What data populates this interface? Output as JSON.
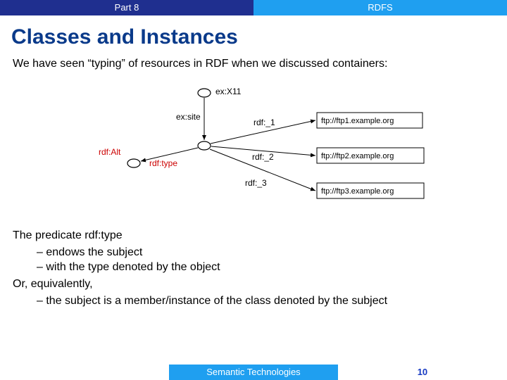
{
  "header": {
    "left": "Part 8",
    "right": "RDFS"
  },
  "title": "Classes and Instances",
  "intro": "We have seen “typing” of resources in RDF when we discussed containers:",
  "diagram": {
    "nodeTop": "ex:X11",
    "edgeSite": "ex:site",
    "nodeAlt": "rdf:Alt",
    "edgeType": "rdf:type",
    "edge1": "rdf:_1",
    "edge2": "rdf:_2",
    "edge3": "rdf:_3",
    "url1": "ftp://ftp1.example.org",
    "url2": "ftp://ftp2.example.org",
    "url3": "ftp://ftp3.example.org"
  },
  "lower": {
    "line1": "The predicate rdf:type",
    "bullets1": [
      "endows the subject",
      "with the type denoted by the object"
    ],
    "line2": "Or, equivalently,",
    "bullets2": [
      "the subject is a member/instance of the class denoted by the subject"
    ]
  },
  "footer": {
    "mid": "Semantic Technologies",
    "page": "10"
  }
}
